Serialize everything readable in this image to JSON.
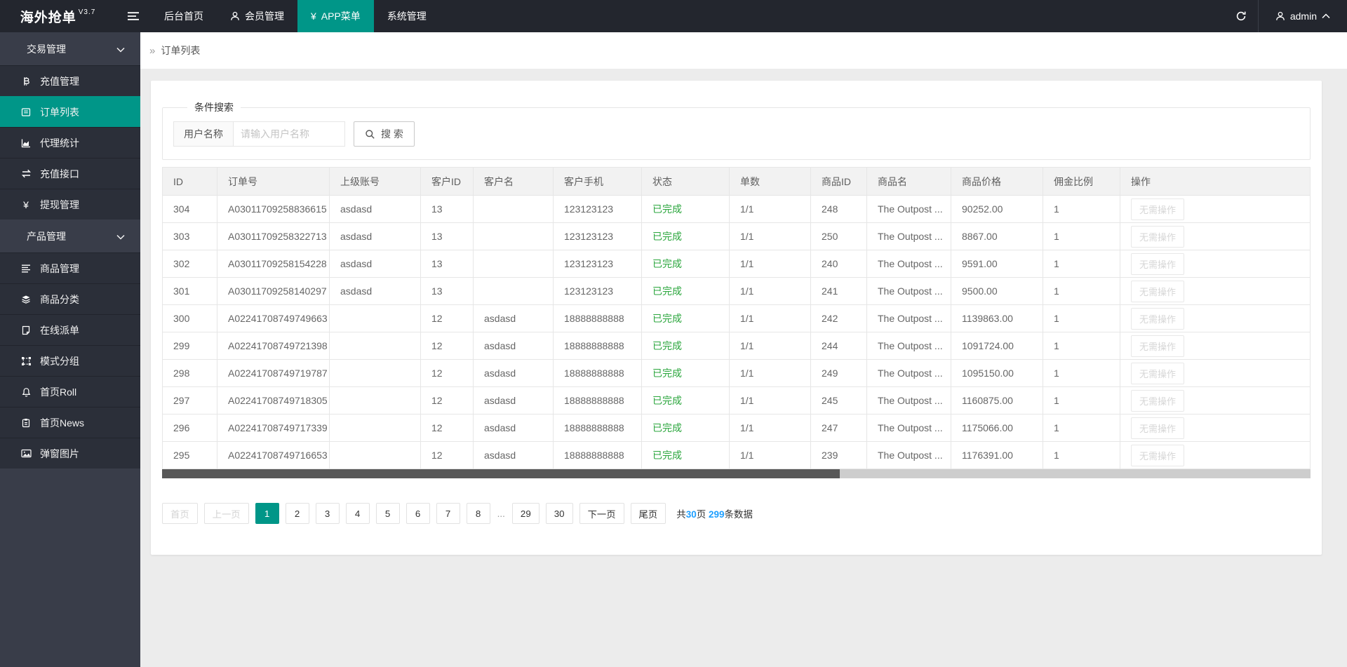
{
  "colors": {
    "accent": "#009688",
    "status_green": "#2aa63c",
    "link_blue": "#1E9FFF",
    "topbar_bg": "#23262E",
    "sidebar_bg": "#393D49"
  },
  "topbar": {
    "logo": "海外抢单",
    "version": "V3.7",
    "username": "admin",
    "menu": [
      {
        "label": "后台首页",
        "icon": "",
        "active": false
      },
      {
        "label": "会员管理",
        "icon": "user-icon",
        "active": false
      },
      {
        "label": "APP菜单",
        "icon": "yen-icon",
        "active": true
      },
      {
        "label": "系统管理",
        "icon": "",
        "active": false
      }
    ]
  },
  "sidebar": {
    "items": [
      {
        "label": "交易管理",
        "type": "header",
        "icon": "",
        "chevron": "chevron-down-icon",
        "active": false
      },
      {
        "label": "充值管理",
        "type": "item",
        "icon": "bitcoin-icon",
        "active": false
      },
      {
        "label": "订单列表",
        "type": "item",
        "icon": "order-list-icon",
        "active": true
      },
      {
        "label": "代理统计",
        "type": "item",
        "icon": "chart-icon",
        "active": false
      },
      {
        "label": "充值接口",
        "type": "item",
        "icon": "exchange-icon",
        "active": false
      },
      {
        "label": "提现管理",
        "type": "item",
        "icon": "yen-icon",
        "active": false
      },
      {
        "label": "产品管理",
        "type": "header",
        "icon": "",
        "chevron": "chevron-down-icon",
        "active": false
      },
      {
        "label": "商品管理",
        "type": "item",
        "icon": "list-icon",
        "active": false
      },
      {
        "label": "商品分类",
        "type": "item",
        "icon": "layers-icon",
        "active": false
      },
      {
        "label": "在线派单",
        "type": "item",
        "icon": "page-icon",
        "active": false
      },
      {
        "label": "模式分组",
        "type": "item",
        "icon": "group-icon",
        "active": false
      },
      {
        "label": "首页Roll",
        "type": "item",
        "icon": "bell-icon",
        "active": false
      },
      {
        "label": "首页News",
        "type": "item",
        "icon": "news-icon",
        "active": false
      },
      {
        "label": "弹窗图片",
        "type": "item",
        "icon": "image-icon",
        "active": false
      }
    ]
  },
  "breadcrumb": {
    "arrow": "»",
    "title": "订单列表"
  },
  "search": {
    "legend": "条件搜索",
    "label": "用户名称",
    "placeholder": "请输入用户名称",
    "button": "搜 索"
  },
  "table": {
    "columns": [
      "ID",
      "订单号",
      "上级账号",
      "客户ID",
      "客户名",
      "客户手机",
      "状态",
      "单数",
      "商品ID",
      "商品名",
      "商品价格",
      "佣金比例",
      "操作"
    ],
    "rows": [
      [
        "304",
        "A03011709258836615",
        "asdasd",
        "13",
        "",
        "123123123",
        "已完成",
        "1/1",
        "248",
        "The Outpost ...",
        "90252.00",
        "1",
        "无需操作"
      ],
      [
        "303",
        "A03011709258322713",
        "asdasd",
        "13",
        "",
        "123123123",
        "已完成",
        "1/1",
        "250",
        "The Outpost ...",
        "8867.00",
        "1",
        "无需操作"
      ],
      [
        "302",
        "A03011709258154228",
        "asdasd",
        "13",
        "",
        "123123123",
        "已完成",
        "1/1",
        "240",
        "The Outpost ...",
        "9591.00",
        "1",
        "无需操作"
      ],
      [
        "301",
        "A03011709258140297",
        "asdasd",
        "13",
        "",
        "123123123",
        "已完成",
        "1/1",
        "241",
        "The Outpost ...",
        "9500.00",
        "1",
        "无需操作"
      ],
      [
        "300",
        "A02241708749749663",
        "",
        "12",
        "asdasd",
        "18888888888",
        "已完成",
        "1/1",
        "242",
        "The Outpost ...",
        "1139863.00",
        "1",
        "无需操作"
      ],
      [
        "299",
        "A02241708749721398",
        "",
        "12",
        "asdasd",
        "18888888888",
        "已完成",
        "1/1",
        "244",
        "The Outpost ...",
        "1091724.00",
        "1",
        "无需操作"
      ],
      [
        "298",
        "A02241708749719787",
        "",
        "12",
        "asdasd",
        "18888888888",
        "已完成",
        "1/1",
        "249",
        "The Outpost ...",
        "1095150.00",
        "1",
        "无需操作"
      ],
      [
        "297",
        "A02241708749718305",
        "",
        "12",
        "asdasd",
        "18888888888",
        "已完成",
        "1/1",
        "245",
        "The Outpost ...",
        "1160875.00",
        "1",
        "无需操作"
      ],
      [
        "296",
        "A02241708749717339",
        "",
        "12",
        "asdasd",
        "18888888888",
        "已完成",
        "1/1",
        "247",
        "The Outpost ...",
        "1175066.00",
        "1",
        "无需操作"
      ],
      [
        "295",
        "A02241708749716653",
        "",
        "12",
        "asdasd",
        "18888888888",
        "已完成",
        "1/1",
        "239",
        "The Outpost ...",
        "1176391.00",
        "1",
        "无需操作"
      ]
    ]
  },
  "pagination": {
    "first": "首页",
    "prev": "上一页",
    "pages": [
      "1",
      "2",
      "3",
      "4",
      "5",
      "6",
      "7",
      "8",
      "...",
      "29",
      "30"
    ],
    "active": "1",
    "next": "下一页",
    "last": "尾页",
    "summary": {
      "prefix": "共",
      "total_pages": "30",
      "pages_unit": "页",
      "total_records": "299",
      "records_unit": "条数据"
    }
  }
}
